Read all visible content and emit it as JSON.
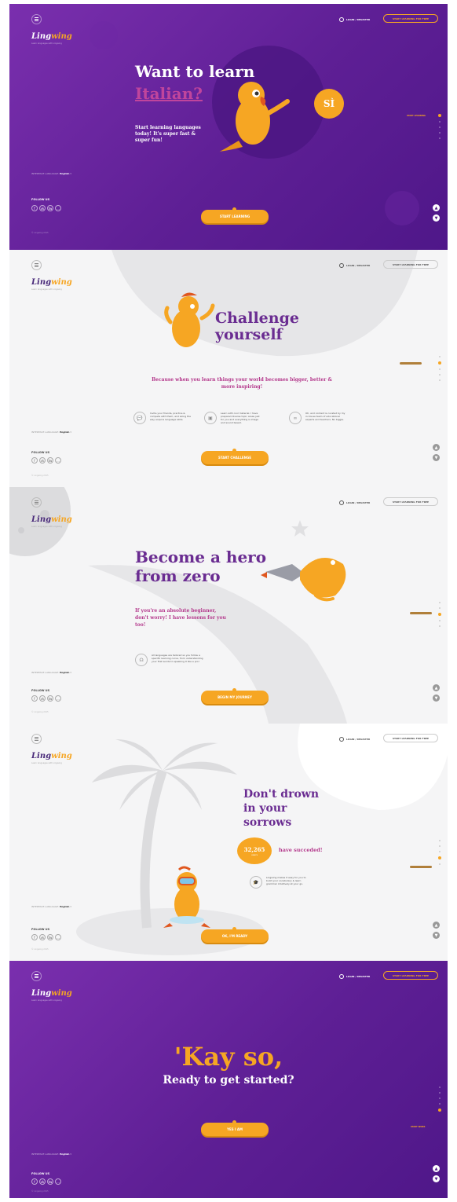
{
  "common": {
    "logo_a": "Ling",
    "logo_b": "wing",
    "tagline": "Learn languages with Lingwing",
    "login": "LOGIN / REGISTER",
    "cta_top": "START LEARNING FOR FREE",
    "lang_label": "INTERFACE LANGUAGE:",
    "lang_value": "English",
    "follow": "FOLLOW US",
    "copyright": "© Lingwing 2015",
    "social": [
      "f",
      "vk",
      "tw",
      "..."
    ]
  },
  "slide1": {
    "title": "Want to learn",
    "language": "Italian?",
    "bubble": "SÌ",
    "body": "Start learning languages today! It's super fast & super fun!",
    "button": "START LEARNING",
    "nav_label": "START LEARNING"
  },
  "slide2": {
    "title_1": "Challenge",
    "title_2": "yourself",
    "subtitle": "Because when you learn things your world becomes bigger, better & more inspiring!",
    "features": [
      "Invite your friends, practice & compete with them, and along the way acquire language skills.",
      "Learn with cool material. I have prepared diverse topic areas just for you and everything is image and sound based.",
      "Oh, and content is curated by my in-house team of educational experts and teachers. No biggie."
    ],
    "button": "START CHALLENGE"
  },
  "slide3": {
    "title_1": "Become a hero",
    "title_2": "from zero",
    "body": "If you're an absolute beginner, don't worry! I have lessons for you too!",
    "feature": "All languages are tailored so you follow a specific learning curve, from understanding your first words to speaking it like a pro!",
    "button": "BEGIN MY JOURNEY"
  },
  "slide4": {
    "title_1": "Don't drown",
    "title_2": "in your",
    "title_3": "sorrows",
    "count": "32,265",
    "count_unit": "users",
    "count_text": "have succeded!",
    "feature": "Lingwing makes it easy for you to build your vocabulary & learn grammar intuitively at your go.",
    "button": "OK, I'M READY"
  },
  "slide5": {
    "title_1": "'Kay so,",
    "title_2": "Ready to get started?",
    "button": "YES I AM",
    "nav_label": "START WORK"
  }
}
